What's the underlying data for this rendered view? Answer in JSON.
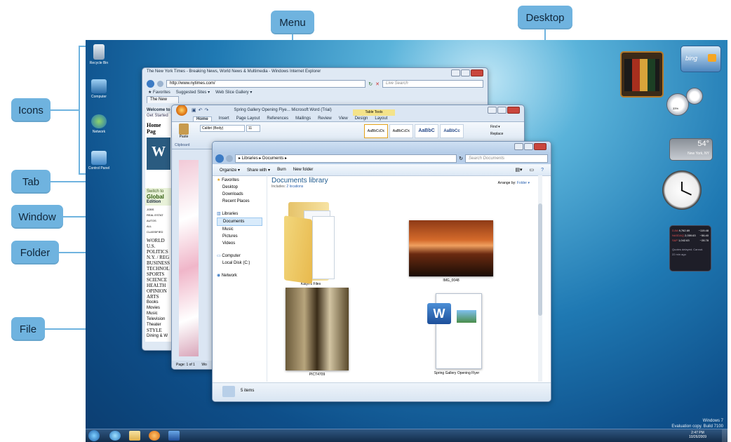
{
  "callouts": {
    "menu": "Menu",
    "desktop": "Desktop",
    "icons": "Icons",
    "tab": "Tab",
    "window": "Window",
    "folder": "Folder",
    "file": "File"
  },
  "desktop_icons": [
    "Recycle Bin",
    "Computer",
    "Network",
    "Control Panel"
  ],
  "ie": {
    "title": "The New York Times - Breaking News, World News & Multimedia - Windows Internet Explorer",
    "url": "http://www.nytimes.com/",
    "search_placeholder": "Live Search",
    "favorites": "Favorites",
    "suggested": "Suggested Sites ▾",
    "webslice": "Web Slice Gallery ▾",
    "tab": "The New",
    "welcome": "Welcome to",
    "get_started": "Get Started",
    "home_page": "Home Pag",
    "switch": "Switch to",
    "global": "Global",
    "edition": "Edition",
    "sections": [
      "JOBS",
      "REAL ESTAT",
      "AUTOS",
      "ALL",
      "CLASSIFIED",
      "WORLD",
      "U.S.",
      "POLITICS",
      "N.Y. / REG",
      "BUSINESS",
      "TECHNOL",
      "SPORTS",
      "SCIENCE",
      "HEALTH",
      "OPINION",
      "ARTS",
      "Books",
      "Movies",
      "Music",
      "Television",
      "Theater",
      "STYLE",
      "Dining & W"
    ]
  },
  "word": {
    "title": "Spring Gallery Opening Flye... Microsoft Word (Trial)",
    "table_tools": "Table Tools",
    "tabs": [
      "Home",
      "Insert",
      "Page Layout",
      "References",
      "Mailings",
      "Review",
      "View",
      "Design",
      "Layout"
    ],
    "font": "Calibri (Body)",
    "size": "11",
    "paste": "Paste",
    "clipboard": "Clipboard",
    "styles": [
      "AaBbCcDc",
      "AaBbCcDc",
      "AaBbC",
      "AaBbCc"
    ],
    "find": "Find ▾",
    "replace": "Replace",
    "status": "Page: 1 of 1",
    "status2": "Wo"
  },
  "explorer": {
    "path": "▸ Libraries ▸ Documents ▸",
    "search_placeholder": "Search Documents",
    "toolbar": [
      "Organize ▾",
      "Share with ▾",
      "Burn",
      "New folder"
    ],
    "nav": {
      "favorites": "Favorites",
      "favorites_items": [
        "Desktop",
        "Downloads",
        "Recent Places"
      ],
      "libraries": "Libraries",
      "libraries_items": [
        "Documents",
        "Music",
        "Pictures",
        "Videos"
      ],
      "computer": "Computer",
      "computer_items": [
        "Local Disk (C:)"
      ],
      "network": "Network"
    },
    "library_title": "Documents library",
    "includes": "Includes:",
    "locations": "2 locations",
    "arrange_by": "Arrange by:",
    "arrange_value": "Folder ▾",
    "items": [
      "Katyn's Files",
      "IMG_0048",
      "PICT4709",
      "Spring Gallery Opening Flyer"
    ],
    "status": "5 items"
  },
  "gadgets": {
    "bing": "bing",
    "weather_temp": "54°",
    "weather_city": "New York, NY",
    "cpu": "33%",
    "stocks": [
      {
        "name": "DJIA",
        "value": "9,762.69",
        "change": "−119.48"
      },
      {
        "name": "NASDAQ",
        "value": "2,059.63",
        "change": "−56.40"
      },
      {
        "name": "S&P",
        "value": "1,042.63",
        "change": "−28.78"
      }
    ],
    "stocks_footer": "Quotes delayed. Cannot.",
    "stocks_time": "22 min ago"
  },
  "watermark": {
    "line1": "Windows 7",
    "line2": "Evaluation copy. Build 7100"
  },
  "taskbar": {
    "time": "2:47 PM",
    "date": "10/26/2009"
  },
  "colors": {
    "callout": "#6fb3df",
    "desktop": "#1f79b3",
    "taskbar": "#16365c",
    "close": "#c9463d"
  }
}
